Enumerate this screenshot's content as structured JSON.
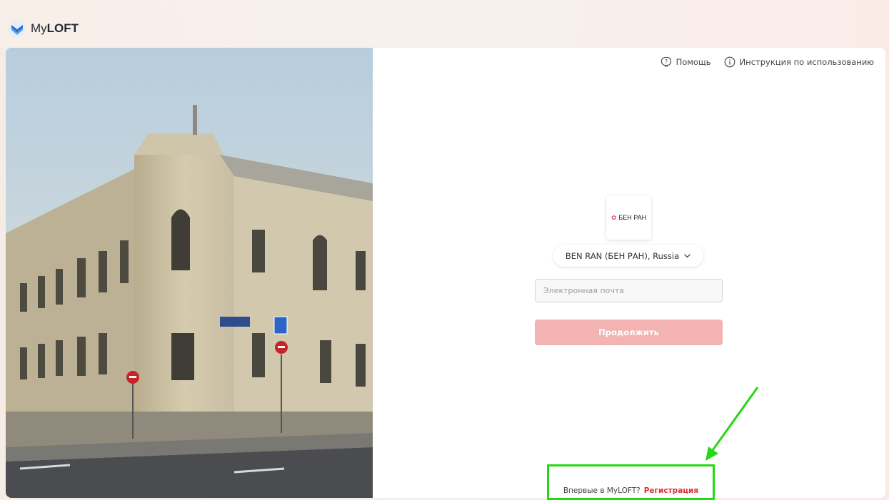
{
  "app": {
    "brand_prefix": "My",
    "brand_bold": "LOFT"
  },
  "help": {
    "help_label": "Помощь",
    "instructions_label": "Инструкция по использованию"
  },
  "login": {
    "org_logo_text": "БЕН РАН",
    "org_select_value": "BEN RAN (БЕН РАН), Russia",
    "email_placeholder": "Электронная почта",
    "email_value": "",
    "continue_label": "Продолжить",
    "first_time_text": "Впервые в MyLOFT?",
    "register_label": "Регистрация"
  },
  "colors": {
    "accent": "#d7323a",
    "button_disabled": "#f2b3b2",
    "highlight": "#25d911"
  },
  "icons": {
    "help": "help-bubble-icon",
    "info": "info-icon",
    "dropdown": "chevron-down-icon",
    "brand": "myloft-logo-icon",
    "org_flower": "flower-icon"
  }
}
